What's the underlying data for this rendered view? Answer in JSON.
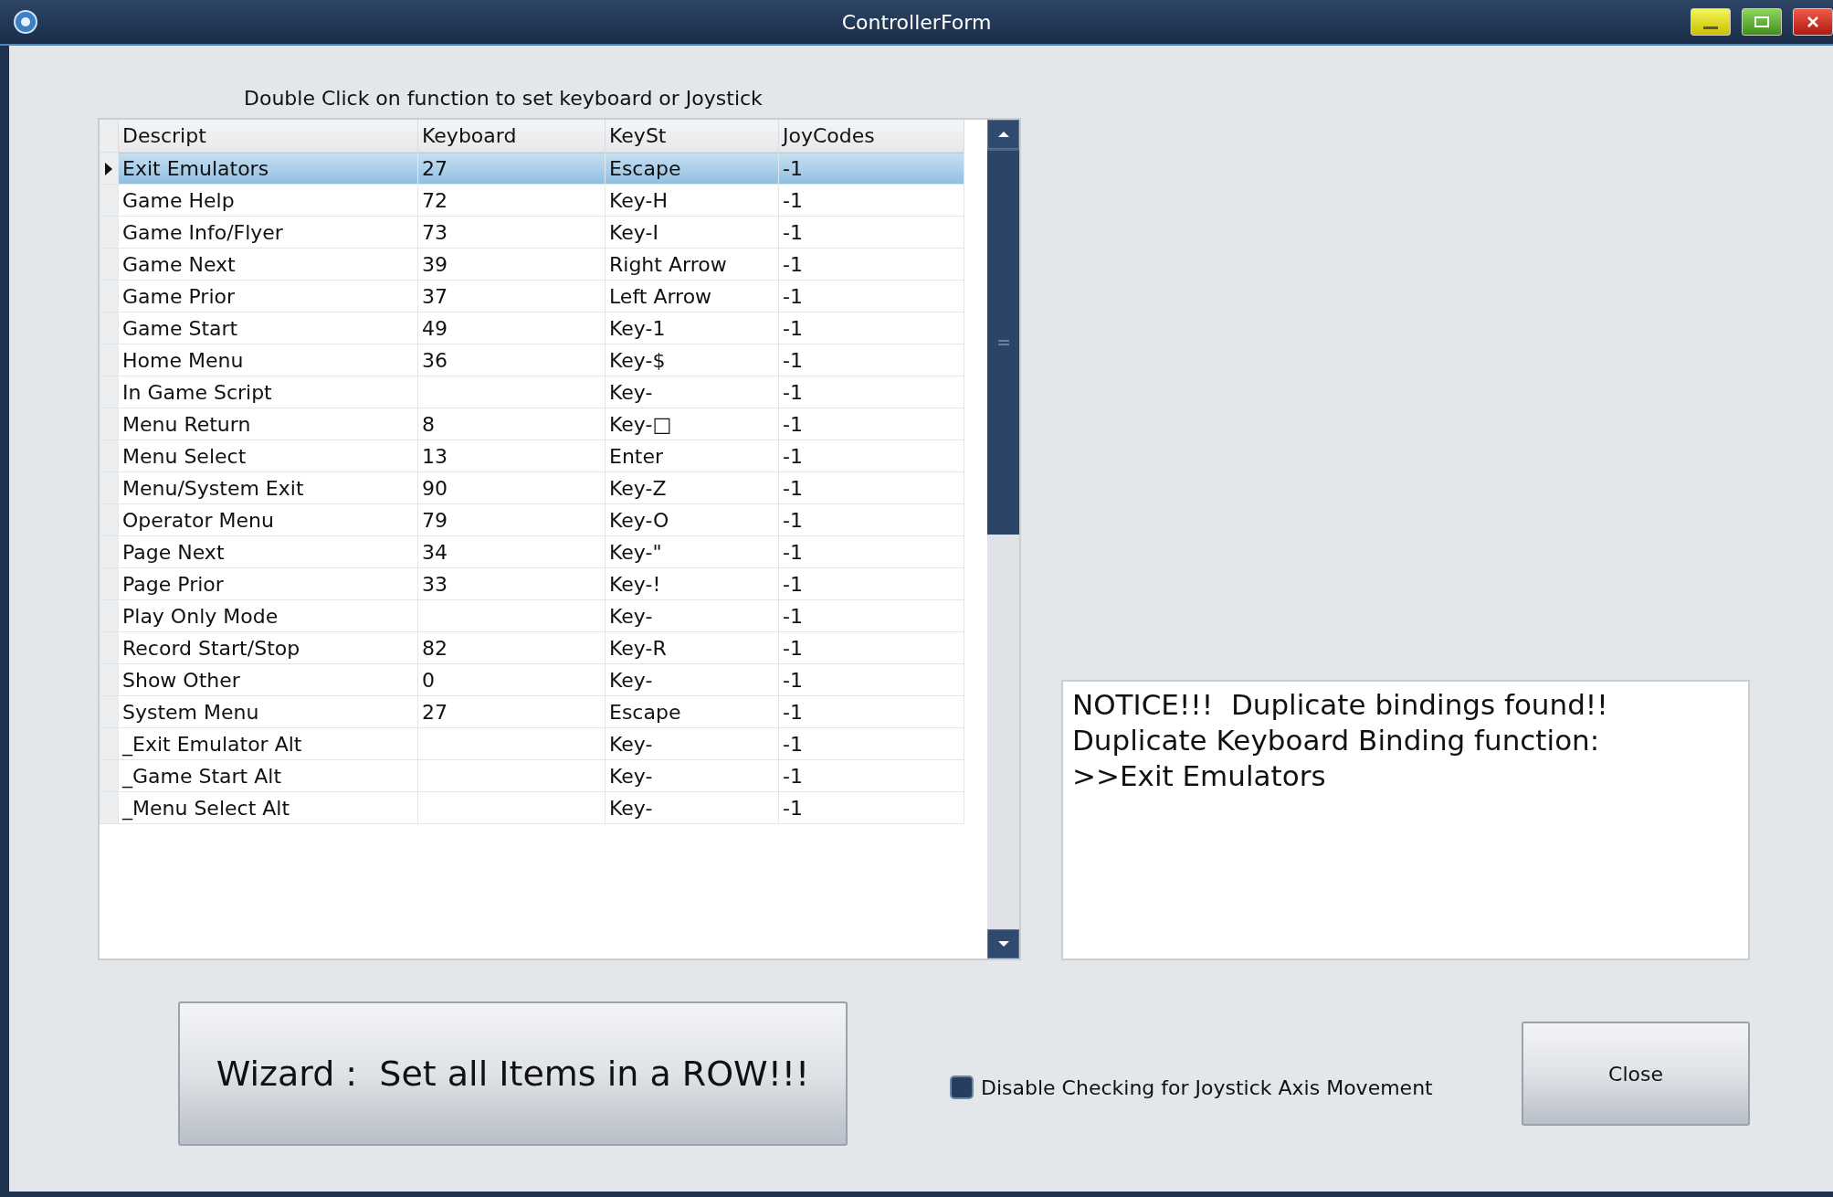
{
  "window": {
    "title": "ControllerForm"
  },
  "instruction": "Double Click on function to set keyboard or Joystick",
  "table": {
    "columns": [
      "Descript",
      "Keyboard",
      "KeySt",
      "JoyCodes"
    ],
    "rows": [
      {
        "cells": [
          "Exit Emulators",
          "27",
          "Escape",
          "-1"
        ],
        "selected": true
      },
      {
        "cells": [
          "Game Help",
          "72",
          "Key-H",
          "-1"
        ],
        "selected": false
      },
      {
        "cells": [
          "Game Info/Flyer",
          "73",
          "Key-I",
          "-1"
        ],
        "selected": false
      },
      {
        "cells": [
          "Game Next",
          "39",
          "Right Arrow",
          "-1"
        ],
        "selected": false
      },
      {
        "cells": [
          "Game Prior",
          "37",
          "Left Arrow",
          "-1"
        ],
        "selected": false
      },
      {
        "cells": [
          "Game Start",
          "49",
          "Key-1",
          "-1"
        ],
        "selected": false
      },
      {
        "cells": [
          "Home Menu",
          "36",
          "Key-$",
          "-1"
        ],
        "selected": false
      },
      {
        "cells": [
          "In Game Script",
          "",
          "Key-",
          "-1"
        ],
        "selected": false
      },
      {
        "cells": [
          "Menu Return",
          "8",
          "Key-□",
          "-1"
        ],
        "selected": false
      },
      {
        "cells": [
          "Menu Select",
          "13",
          "Enter",
          "-1"
        ],
        "selected": false
      },
      {
        "cells": [
          "Menu/System Exit",
          "90",
          "Key-Z",
          "-1"
        ],
        "selected": false
      },
      {
        "cells": [
          "Operator Menu",
          "79",
          "Key-O",
          "-1"
        ],
        "selected": false
      },
      {
        "cells": [
          "Page Next",
          "34",
          "Key-\"",
          "-1"
        ],
        "selected": false
      },
      {
        "cells": [
          "Page Prior",
          "33",
          "Key-!",
          "-1"
        ],
        "selected": false
      },
      {
        "cells": [
          "Play Only Mode",
          "",
          "Key-",
          "-1"
        ],
        "selected": false
      },
      {
        "cells": [
          "Record Start/Stop",
          "82",
          "Key-R",
          "-1"
        ],
        "selected": false
      },
      {
        "cells": [
          "Show Other",
          "0",
          "Key-",
          "-1"
        ],
        "selected": false
      },
      {
        "cells": [
          "System Menu",
          "27",
          "Escape",
          "-1"
        ],
        "selected": false
      },
      {
        "cells": [
          "_Exit Emulator Alt",
          "",
          "Key-",
          "-1"
        ],
        "selected": false
      },
      {
        "cells": [
          "_Game Start Alt",
          "",
          "Key-",
          "-1"
        ],
        "selected": false
      },
      {
        "cells": [
          "_Menu Select Alt",
          "",
          "Key-",
          "-1"
        ],
        "selected": false
      }
    ]
  },
  "notice": [
    "NOTICE!!!  Duplicate bindings found!!",
    "Duplicate Keyboard Binding function:",
    ">>Exit Emulators"
  ],
  "wizard_button": "Wizard :  Set all Items in a ROW!!!",
  "checkbox": {
    "label": "Disable Checking for Joystick Axis Movement",
    "checked": false
  },
  "close_button": "Close"
}
